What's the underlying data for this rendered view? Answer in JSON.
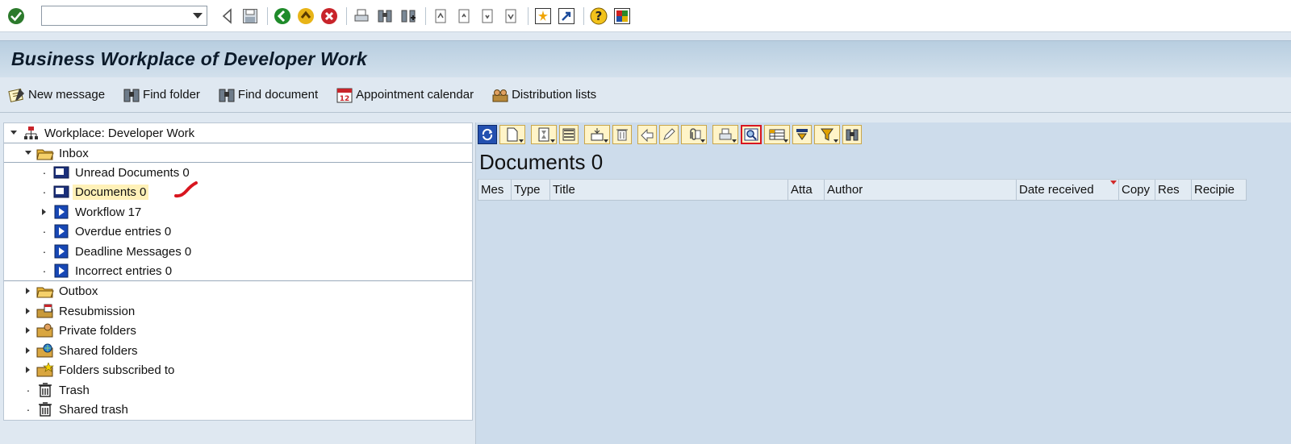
{
  "command_field": {
    "value": ""
  },
  "title": "Business Workplace of Developer Work",
  "app_toolbar": [
    {
      "label": "New message",
      "icon": "new-message-icon"
    },
    {
      "label": "Find folder",
      "icon": "binoculars-icon"
    },
    {
      "label": "Find document",
      "icon": "binoculars-icon"
    },
    {
      "label": "Appointment calendar",
      "icon": "calendar-icon"
    },
    {
      "label": "Distribution lists",
      "icon": "distribution-list-icon"
    }
  ],
  "tree": {
    "root": "Workplace: Developer Work",
    "inbox": "Inbox",
    "inbox_items": [
      "Unread Documents 0",
      "Documents 0",
      "Workflow 17",
      "Overdue entries 0",
      "Deadline Messages 0",
      "Incorrect entries 0"
    ],
    "folders": [
      "Outbox",
      "Resubmission",
      "Private folders",
      "Shared folders",
      "Folders subscribed to",
      "Trash",
      "Shared trash"
    ],
    "selected": "Documents 0"
  },
  "right_panel": {
    "heading": "Documents 0",
    "columns": [
      "Mes",
      "Type",
      "Title",
      "Atta",
      "Author",
      "Date received",
      "Copy",
      "Res",
      "Recipie"
    ]
  },
  "colors": {
    "selection": "#fff1b8",
    "title_bar": "#c4d7e8",
    "panel_bg": "#cddceb",
    "annotation_red": "#d8161f"
  }
}
